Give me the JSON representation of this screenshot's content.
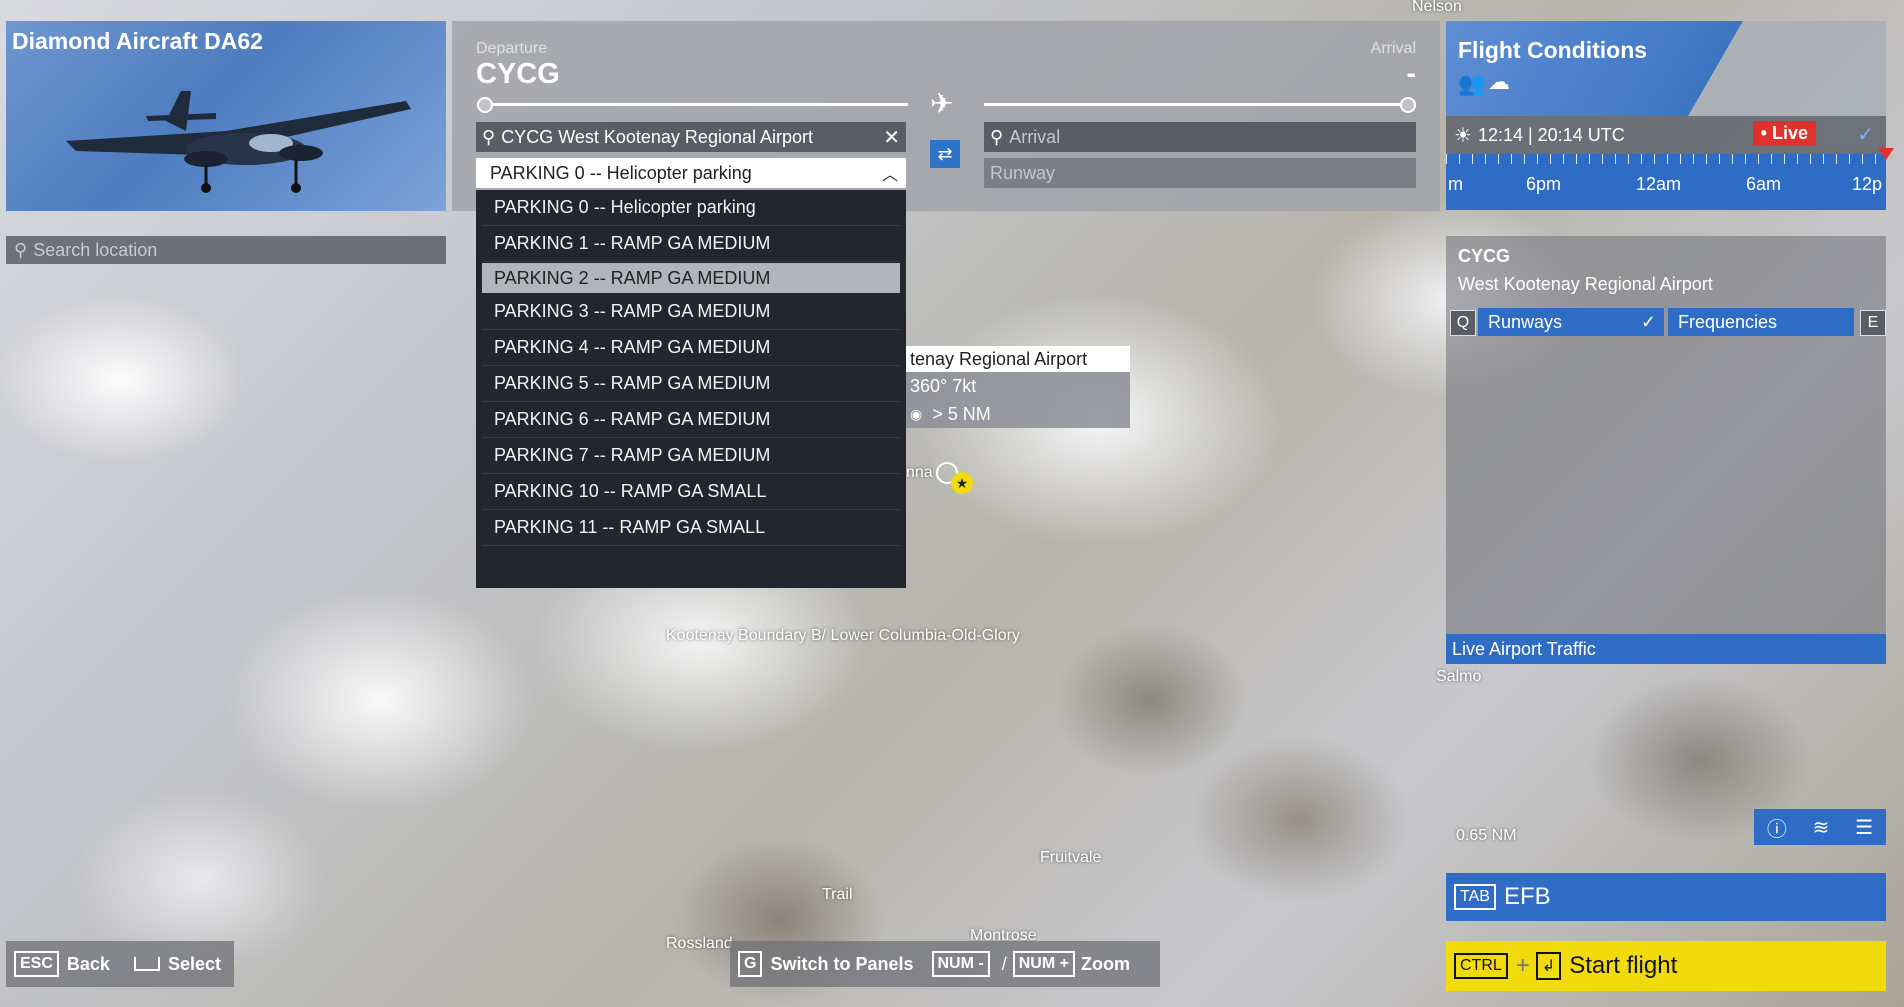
{
  "aircraft": {
    "name": "Diamond Aircraft DA62"
  },
  "search_location": {
    "placeholder": "Search location"
  },
  "departure": {
    "label": "Departure",
    "code": "CYCG",
    "airport_field": "CYCG West Kootenay Regional Airport",
    "parking_selected": "PARKING 0 -- Helicopter parking"
  },
  "arrival": {
    "label": "Arrival",
    "code": "-",
    "airport_placeholder": "Arrival",
    "runway_placeholder": "Runway"
  },
  "parking_options": [
    "PARKING 0 -- Helicopter parking",
    "PARKING 1 -- RAMP GA MEDIUM",
    "PARKING 2 -- RAMP GA MEDIUM",
    "PARKING 3 -- RAMP GA MEDIUM",
    "PARKING 4 -- RAMP GA MEDIUM",
    "PARKING 5 -- RAMP GA MEDIUM",
    "PARKING 6 -- RAMP GA MEDIUM",
    "PARKING 7 -- RAMP GA MEDIUM",
    "PARKING 10 -- RAMP GA SMALL",
    "PARKING 11 -- RAMP GA SMALL"
  ],
  "parking_highlighted_index": 2,
  "tooltip": {
    "name": "tenay Regional Airport",
    "wind": "360° 7kt",
    "visibility": "> 5 NM",
    "place_fragment": "nna"
  },
  "flight_conditions": {
    "title": "Flight Conditions",
    "time": "12:14 | 20:14 UTC",
    "live_label": "• Live",
    "timeline_labels": [
      "m",
      "6pm",
      "12am",
      "6am",
      "12p"
    ]
  },
  "airport_info": {
    "code": "CYCG",
    "name": "West Kootenay Regional Airport",
    "key_left": "Q",
    "key_right": "E",
    "tab_runways": "Runways",
    "tab_frequencies": "Frequencies",
    "live_traffic": "Live Airport Traffic"
  },
  "map_labels": {
    "nelson": "Nelson",
    "salmo": "Salmo",
    "boundary": "Kootenay Boundary B/ Lower Columbia-Old-Glory",
    "fruitvale": "Fruitvale",
    "trail": "Trail",
    "rossland": "Rossland",
    "montrose": "Montrose",
    "scale": "0.65 NM"
  },
  "efb": {
    "key": "TAB",
    "label": "EFB"
  },
  "start_flight": {
    "key": "CTRL",
    "plus": "+",
    "enter": "↲",
    "label": "Start flight"
  },
  "controls_left": {
    "esc_key": "ESC",
    "back": "Back",
    "select": "Select"
  },
  "controls_center": {
    "g_key": "G",
    "switch": "Switch to Panels",
    "num_minus": "NUM -",
    "slash": "/",
    "num_plus": "NUM +",
    "zoom": "Zoom"
  },
  "colors": {
    "accent": "#2e6cc5",
    "live": "#e0312f",
    "start": "#f2db0c"
  }
}
